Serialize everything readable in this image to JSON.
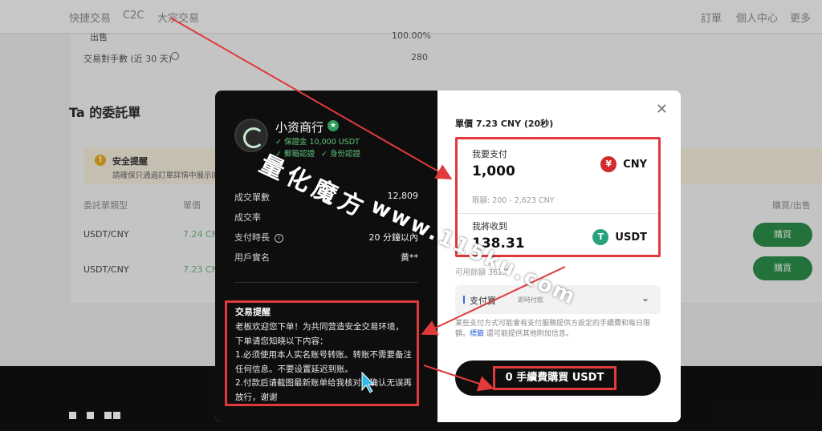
{
  "topnav": {
    "items": [
      "快捷交易",
      "C2C",
      "大宗交易"
    ],
    "right": [
      "訂單",
      "個人中心",
      "更多"
    ]
  },
  "background": {
    "sell_label": "出售",
    "sell_value": "100.00%",
    "fee_label": "交易對手數 (近 30 天)",
    "fee_value": "280",
    "section_title": "Ta 的委託單",
    "alert_title": "安全提醒",
    "alert_text": "請確保只通過訂單詳情中展示的",
    "table_headers": [
      "委託單類型",
      "單價",
      "購買/出售"
    ],
    "rows": [
      {
        "type": "USDT/CNY",
        "price": "7.24 CN",
        "action": "購買"
      },
      {
        "type": "USDT/CNY",
        "price": "7.23 CN",
        "action": "購買"
      }
    ]
  },
  "modal": {
    "merchant_name": "小资商行",
    "deposit": "✓ 保證金 10,000 USDT",
    "email_verified": "✓ 郵箱認證",
    "id_verified": "✓ 身份認證",
    "stats": [
      {
        "label": "成交單數",
        "value": "12,809"
      },
      {
        "label": "成交率",
        "value": ""
      },
      {
        "label": "支付時長",
        "value": "20 分鐘以內"
      },
      {
        "label": "用戶實名",
        "value": "黄**"
      }
    ],
    "notice_title": "交易提醒",
    "notice_lines": [
      "老板欢迎您下单！为共同营造安全交易环境，",
      "下单请您知晓以下内容：",
      "1.必须使用本人实名账号转账。转账不需要备注",
      "任何信息。不要设置延迟到账。",
      "2.付款后请截图最新账单给我核对，确认无误再",
      "放行，谢谢"
    ],
    "unit_price": "單價 7.23 CNY (20秒)",
    "pay_label": "我要支付",
    "pay_value": "1,000",
    "pay_currency": "CNY",
    "limit": "限額: 200 - 2,623 CNY",
    "receive_label": "我將收到",
    "receive_value": "138.31",
    "receive_currency": "USDT",
    "balance": "可用餘額 362.7",
    "payment_label": "支付寶",
    "payment_sub": "即時付款",
    "fee_note_1": "某些支付方式可能會有支付服務提供方設定的手續費和每日限",
    "fee_note_2a": "額。",
    "fee_note_link": "標籤",
    "fee_note_2b": " 還可能提供其他附加信息。",
    "buy_button": "0 手續費購買 USDT"
  },
  "watermark": {
    "title": "量化魔方",
    "url": "www.115ku.com"
  },
  "colors": {
    "annotation_red": "#e03a3a",
    "green": "#2c8c48",
    "cny_coin": "#d12b2b",
    "usdt_coin": "#27a17c"
  }
}
